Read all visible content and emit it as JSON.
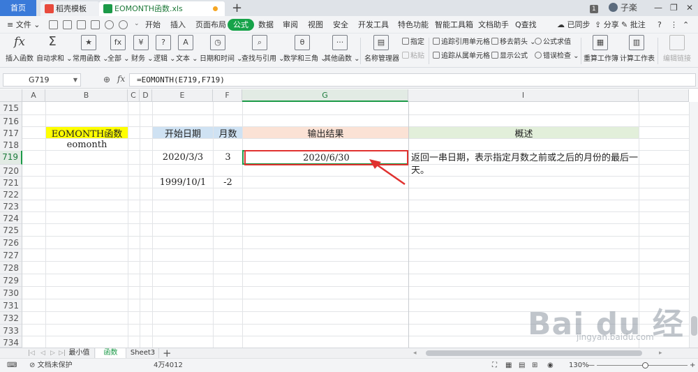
{
  "tabs": {
    "home": "首页",
    "template": "稻壳模板",
    "file": "EOMONTH函数.xls",
    "add": "+"
  },
  "window": {
    "badge": "1",
    "user": "子楽",
    "minimize": "—",
    "restore": "❐",
    "close": "✕"
  },
  "menu": {
    "file": "≡ 文件 ⌄",
    "items": [
      "开始",
      "插入",
      "页面布局",
      "公式",
      "数据",
      "审阅",
      "视图",
      "安全",
      "开发工具",
      "特色功能",
      "智能工具箱",
      "文档助手"
    ],
    "active": "公式",
    "search": "Q查找",
    "sync": "已同步",
    "share": "分享",
    "comment": "批注",
    "help": "?"
  },
  "ribbon": {
    "insert_function": "插入函数",
    "autosum": "自动求和",
    "common": "常用函数",
    "all": "全部",
    "finance": "财务",
    "logic": "逻辑",
    "text": "文本",
    "datetime": "日期和时间",
    "lookup": "查找与引用",
    "math": "数学和三角",
    "other": "其他函数",
    "name_manager": "名称管理器",
    "specify": "指定",
    "paste": "粘贴",
    "trace_precedents": "追踪引用单元格",
    "trace_dependents": "追踪从属单元格",
    "remove_arrows": "移去箭头",
    "show_formulas": "显示公式",
    "evaluate": "公式求值",
    "error_check": "错误检查",
    "recalc_sheet": "重算工作簿",
    "calc_sheet": "计算工作表",
    "edit_links": "编辑链接"
  },
  "formula_bar": {
    "name_box": "G719",
    "fx": "fx",
    "formula": "=EOMONTH(E719,F719)"
  },
  "grid": {
    "columns": [
      {
        "key": "A",
        "label": "A"
      },
      {
        "key": "B",
        "label": "B"
      },
      {
        "key": "C",
        "label": "C"
      },
      {
        "key": "D",
        "label": "D"
      },
      {
        "key": "E",
        "label": "E"
      },
      {
        "key": "F",
        "label": "F"
      },
      {
        "key": "G",
        "label": "G"
      },
      {
        "key": "I",
        "label": "I"
      }
    ],
    "rows": [
      "715",
      "716",
      "717",
      "718",
      "719",
      "720",
      "721",
      "722",
      "723",
      "724",
      "725",
      "726",
      "727",
      "728",
      "729",
      "730",
      "731",
      "732",
      "733",
      "734"
    ],
    "selected_row": "719",
    "selected_col": "G"
  },
  "cells": {
    "b717": "EOMONTH函数",
    "b718": "eomonth",
    "e717": "开始日期",
    "f717": "月数",
    "g717": "输出结果",
    "i717": "概述",
    "e719": "2020/3/3",
    "f719": "3",
    "g719": "2020/6/30",
    "i719": "返回一串日期，表示指定月数之前或之后的月份的最后一天。",
    "e721": "1999/10/1",
    "f721": "-2"
  },
  "sheets": {
    "tabs": [
      "最小值",
      "函数",
      "Sheet3"
    ],
    "active": "函数",
    "add": "+"
  },
  "status": {
    "protect": "文档未保护",
    "count": "4万4012",
    "zoom": "130%",
    "zoom_minus": "—",
    "zoom_plus": "+"
  },
  "watermark": {
    "logo": "Bai du 经验",
    "url": "jingyan.baidu.com"
  },
  "colors": {
    "accent": "#17a34a",
    "highlight_red": "#e0312f",
    "yellow": "#ffff00"
  }
}
